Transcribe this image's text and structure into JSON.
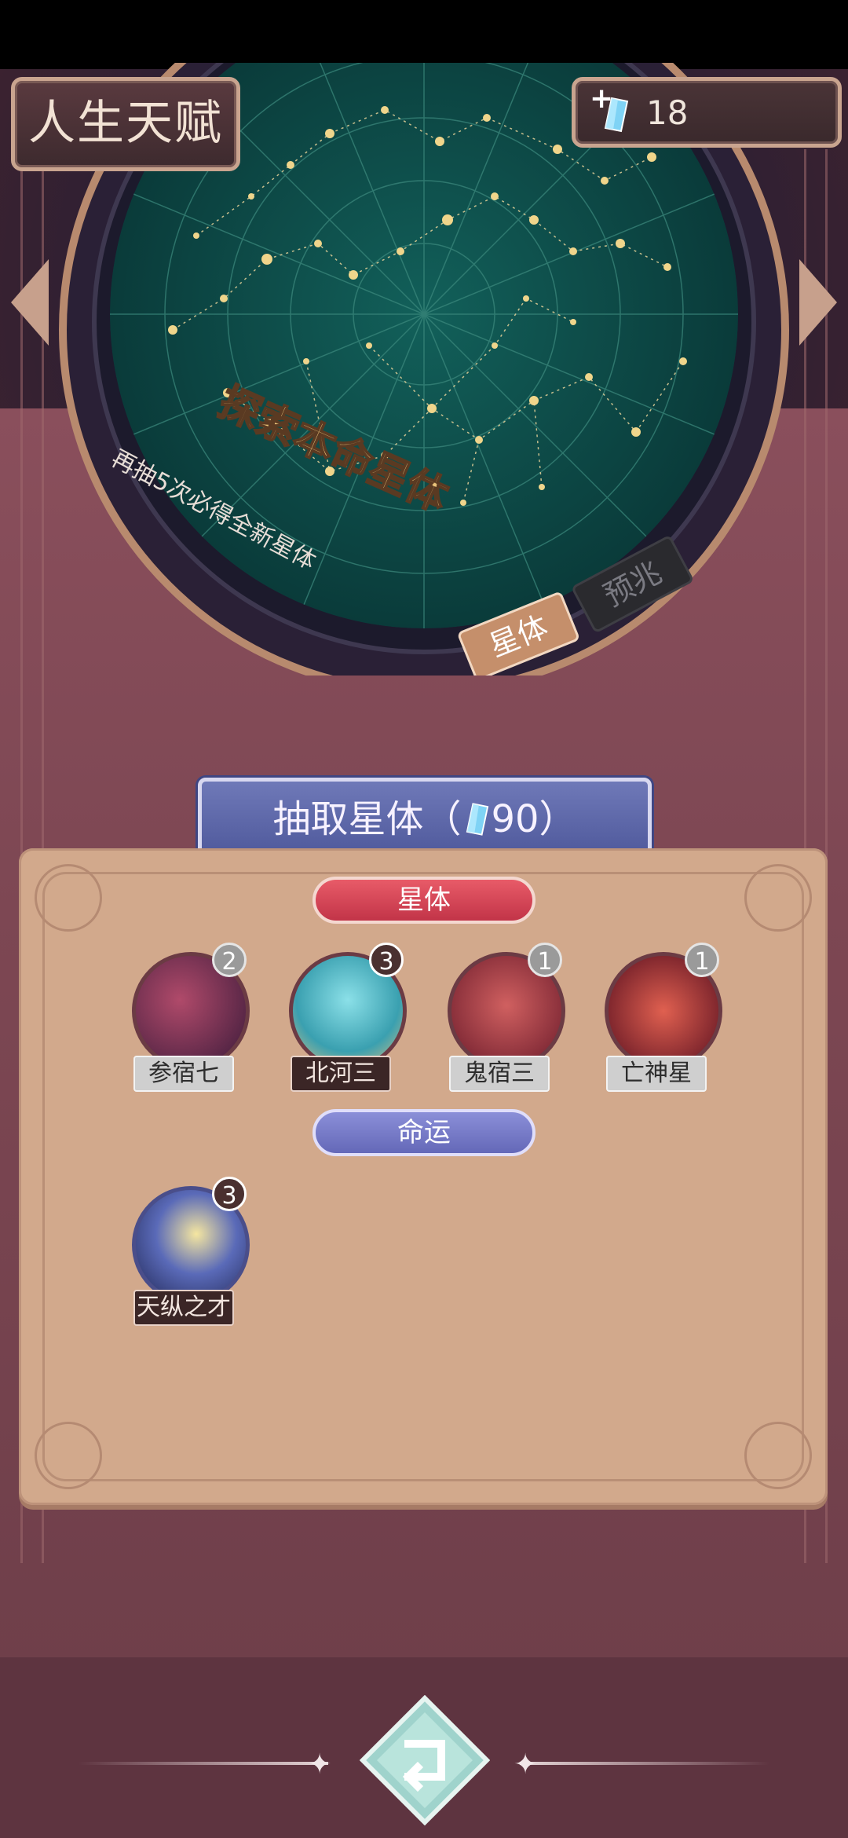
{
  "header": {
    "title": "人生天赋",
    "currency_plus": "+",
    "currency_value": "18"
  },
  "starmap": {
    "headline": "探索本命星体",
    "subtext": "再抽5次必得全新星体",
    "tab_active": "星体",
    "tab_inactive": "预兆"
  },
  "draw_button": {
    "label_prefix": "抽取星体（",
    "cost": "90",
    "label_suffix": "）"
  },
  "sections": {
    "stars_title": "星体",
    "fate_title": "命运"
  },
  "star_items": [
    {
      "name": "参宿七",
      "count": "2"
    },
    {
      "name": "北河三",
      "count": "3"
    },
    {
      "name": "鬼宿三",
      "count": "1"
    },
    {
      "name": "亡神星",
      "count": "1"
    }
  ],
  "fate_items": [
    {
      "name": "天纵之才",
      "count": "3"
    }
  ],
  "icons": {
    "currency": "crystal-icon",
    "back": "return-arrow-icon",
    "nav_left": "arrow-left-icon",
    "nav_right": "arrow-right-icon"
  },
  "colors": {
    "panel": "#d2a98c",
    "accent_red": "#c23448",
    "accent_blue": "#6468b8",
    "starmap_teal": "#0d4a48",
    "gold": "#e8c27a"
  }
}
